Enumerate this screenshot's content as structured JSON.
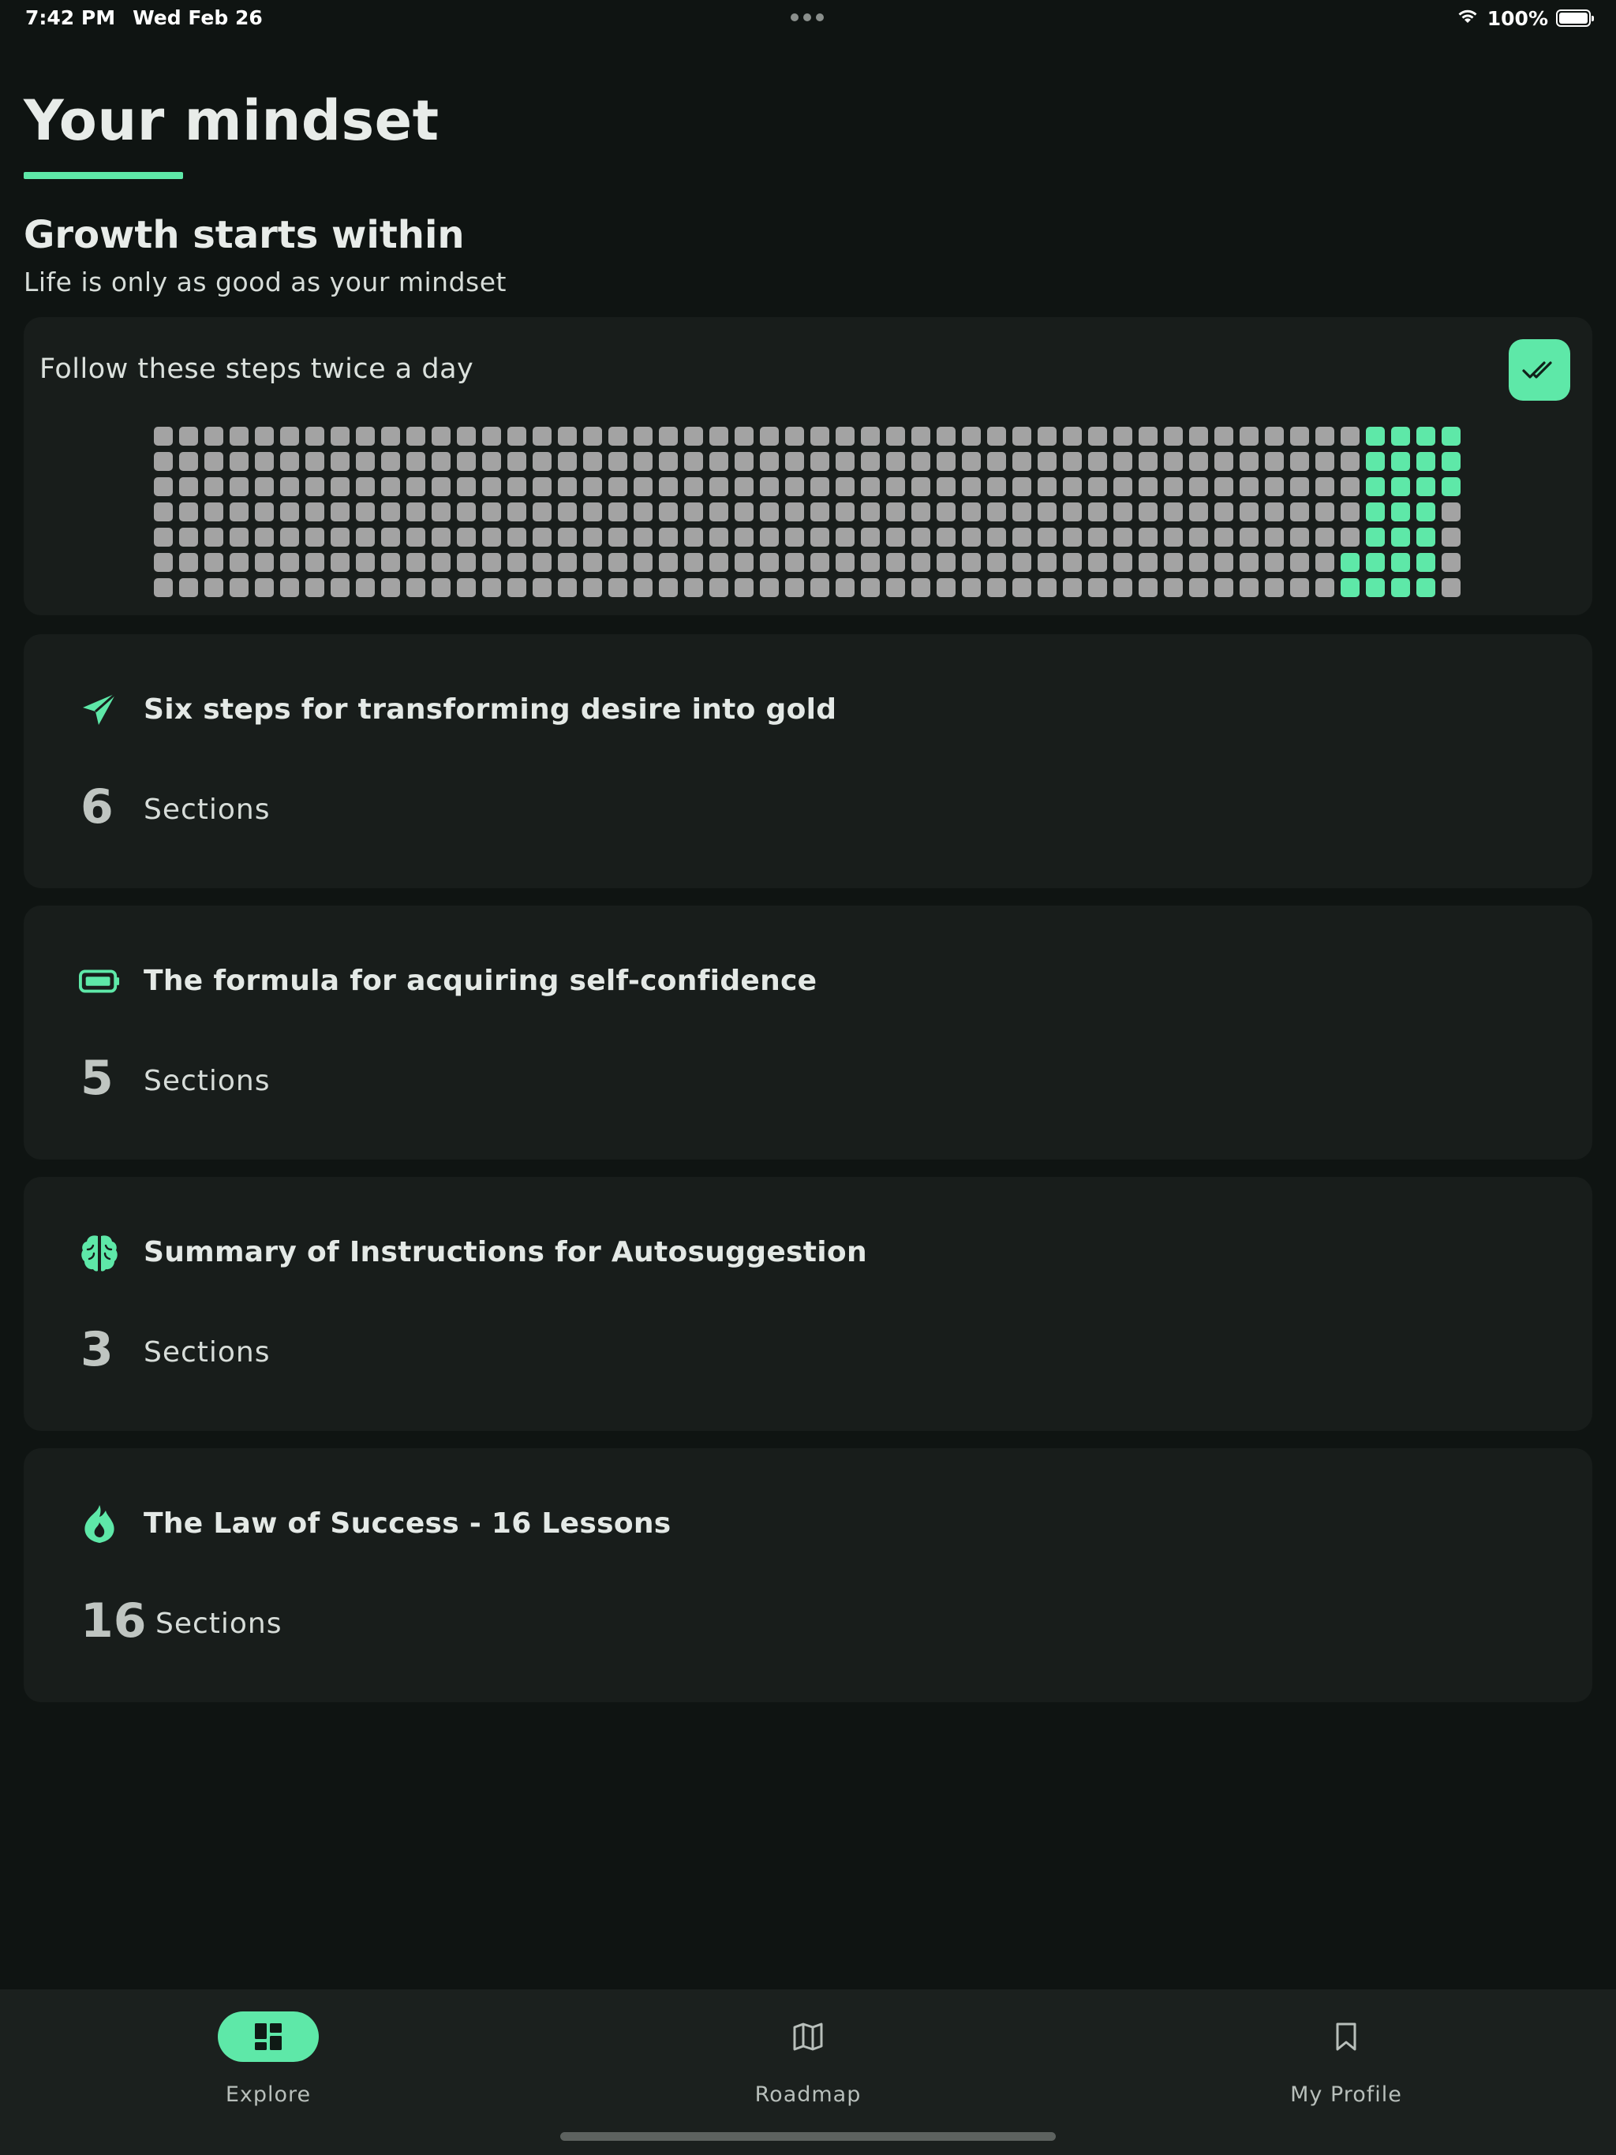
{
  "status_bar": {
    "time": "7:42 PM",
    "date": "Wed Feb 26",
    "battery": "100%",
    "icons": [
      "wifi-icon",
      "battery-icon"
    ]
  },
  "header": {
    "title": "Your mindset",
    "heading": "Growth starts within",
    "subheading": "Life is only as good as your mindset"
  },
  "habit": {
    "text": "Follow these steps twice a day",
    "check_icon": "double-check-icon",
    "grid": {
      "weeks": 52,
      "days": 7,
      "completed": [
        [
          false,
          false,
          false,
          false,
          false,
          false,
          false
        ],
        [
          false,
          false,
          false,
          false,
          false,
          false,
          false
        ],
        [
          false,
          false,
          false,
          false,
          false,
          false,
          false
        ],
        [
          false,
          false,
          false,
          false,
          false,
          false,
          false
        ],
        [
          false,
          false,
          false,
          false,
          false,
          false,
          false
        ],
        [
          false,
          false,
          false,
          false,
          false,
          false,
          false
        ],
        [
          false,
          false,
          false,
          false,
          false,
          false,
          false
        ],
        [
          false,
          false,
          false,
          false,
          false,
          false,
          false
        ],
        [
          false,
          false,
          false,
          false,
          false,
          false,
          false
        ],
        [
          false,
          false,
          false,
          false,
          false,
          false,
          false
        ],
        [
          false,
          false,
          false,
          false,
          false,
          false,
          false
        ],
        [
          false,
          false,
          false,
          false,
          false,
          false,
          false
        ],
        [
          false,
          false,
          false,
          false,
          false,
          false,
          false
        ],
        [
          false,
          false,
          false,
          false,
          false,
          false,
          false
        ],
        [
          false,
          false,
          false,
          false,
          false,
          false,
          false
        ],
        [
          false,
          false,
          false,
          false,
          false,
          false,
          false
        ],
        [
          false,
          false,
          false,
          false,
          false,
          false,
          false
        ],
        [
          false,
          false,
          false,
          false,
          false,
          false,
          false
        ],
        [
          false,
          false,
          false,
          false,
          false,
          false,
          false
        ],
        [
          false,
          false,
          false,
          false,
          false,
          false,
          false
        ],
        [
          false,
          false,
          false,
          false,
          false,
          false,
          false
        ],
        [
          false,
          false,
          false,
          false,
          false,
          false,
          false
        ],
        [
          false,
          false,
          false,
          false,
          false,
          false,
          false
        ],
        [
          false,
          false,
          false,
          false,
          false,
          false,
          false
        ],
        [
          false,
          false,
          false,
          false,
          false,
          false,
          false
        ],
        [
          false,
          false,
          false,
          false,
          false,
          false,
          false
        ],
        [
          false,
          false,
          false,
          false,
          false,
          false,
          false
        ],
        [
          false,
          false,
          false,
          false,
          false,
          false,
          false
        ],
        [
          false,
          false,
          false,
          false,
          false,
          false,
          false
        ],
        [
          false,
          false,
          false,
          false,
          false,
          false,
          false
        ],
        [
          false,
          false,
          false,
          false,
          false,
          false,
          false
        ],
        [
          false,
          false,
          false,
          false,
          false,
          false,
          false
        ],
        [
          false,
          false,
          false,
          false,
          false,
          false,
          false
        ],
        [
          false,
          false,
          false,
          false,
          false,
          false,
          false
        ],
        [
          false,
          false,
          false,
          false,
          false,
          false,
          false
        ],
        [
          false,
          false,
          false,
          false,
          false,
          false,
          false
        ],
        [
          false,
          false,
          false,
          false,
          false,
          false,
          false
        ],
        [
          false,
          false,
          false,
          false,
          false,
          false,
          false
        ],
        [
          false,
          false,
          false,
          false,
          false,
          false,
          false
        ],
        [
          false,
          false,
          false,
          false,
          false,
          false,
          false
        ],
        [
          false,
          false,
          false,
          false,
          false,
          false,
          false
        ],
        [
          false,
          false,
          false,
          false,
          false,
          false,
          false
        ],
        [
          false,
          false,
          false,
          false,
          false,
          false,
          false
        ],
        [
          false,
          false,
          false,
          false,
          false,
          false,
          false
        ],
        [
          false,
          false,
          false,
          false,
          false,
          false,
          false
        ],
        [
          false,
          false,
          false,
          false,
          false,
          false,
          false
        ],
        [
          false,
          false,
          false,
          false,
          false,
          false,
          false
        ],
        [
          false,
          false,
          false,
          false,
          false,
          true,
          true
        ],
        [
          true,
          true,
          true,
          true,
          true,
          true,
          true
        ],
        [
          true,
          true,
          true,
          true,
          true,
          true,
          true
        ],
        [
          true,
          true,
          true,
          true,
          true,
          true,
          true
        ],
        [
          true,
          true,
          true,
          false,
          false,
          false,
          false
        ]
      ]
    }
  },
  "topics": [
    {
      "title": "Six steps for transforming desire into gold",
      "count": "6",
      "count_label": "Sections",
      "icon": "paper-plane-icon"
    },
    {
      "title": "The formula for acquiring self-confidence",
      "count": "5",
      "count_label": "Sections",
      "icon": "battery-full-icon"
    },
    {
      "title": "Summary of Instructions for Autosuggestion",
      "count": "3",
      "count_label": "Sections",
      "icon": "brain-icon"
    },
    {
      "title": "The Law of Success - 16 Lessons",
      "count": "16",
      "count_label": "Sections",
      "icon": "fire-icon"
    }
  ],
  "nav": {
    "items": [
      {
        "label": "Explore",
        "icon": "dashboard-icon",
        "active": true
      },
      {
        "label": "Roadmap",
        "icon": "map-icon",
        "active": false
      },
      {
        "label": "My Profile",
        "icon": "bookmark-icon",
        "active": false
      }
    ]
  },
  "colors": {
    "accent": "#5ee8a8",
    "background": "#0f1412",
    "card": "#181d1b",
    "inactive_cell": "#a3a3a3"
  }
}
